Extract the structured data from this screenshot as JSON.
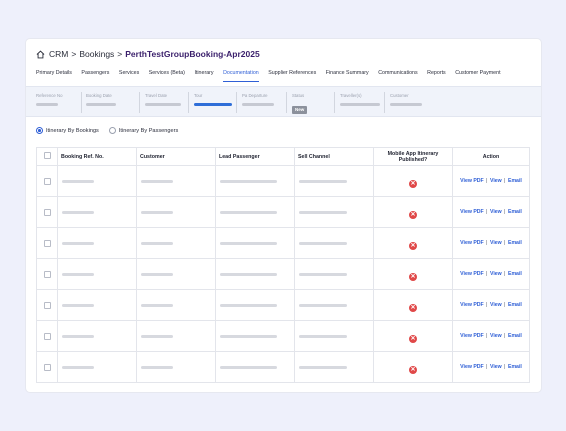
{
  "breadcrumb": {
    "root": "CRM",
    "section": "Bookings",
    "current": "PerthTestGroupBooking-Apr2025",
    "separator": ">"
  },
  "tabs": [
    {
      "label": "Primary Details",
      "active": false
    },
    {
      "label": "Passengers",
      "active": false
    },
    {
      "label": "Services",
      "active": false
    },
    {
      "label": "Services (Beta)",
      "active": false
    },
    {
      "label": "Itinerary",
      "active": false
    },
    {
      "label": "Documentation",
      "active": true
    },
    {
      "label": "Supplier References",
      "active": false
    },
    {
      "label": "Finance Summary",
      "active": false
    },
    {
      "label": "Communications",
      "active": false
    },
    {
      "label": "Reports",
      "active": false
    },
    {
      "label": "Customer Payment",
      "active": false
    }
  ],
  "info": {
    "reference_no": "Reference No",
    "booking_date": "Booking Date",
    "travel_date": "Travel Date",
    "tour": "Tour",
    "pa_departure": "Pa Departure",
    "status": "Status",
    "status_value": "New",
    "travellers": "Traveller(s)",
    "customer": "Customer"
  },
  "view_options": {
    "by_bookings": "Itinerary By Bookings",
    "by_passengers": "Itinerary By Passengers",
    "selected": "by_bookings"
  },
  "table": {
    "headers": {
      "booking_ref": "Booking Ref. No.",
      "customer": "Customer",
      "lead_passenger": "Lead Passenger",
      "sell_channel": "Sell Channel",
      "mobile_app": "Mobile App Itinerary Published?",
      "action": "Action"
    },
    "actions": {
      "view_pdf": "View PDF",
      "view": "View",
      "email": "Email",
      "separator": "|"
    },
    "published_icon": "x-circle-icon",
    "row_count": 7
  },
  "colors": {
    "accent": "#2f5fd6",
    "title": "#3a1f6b",
    "error": "#e04848"
  }
}
